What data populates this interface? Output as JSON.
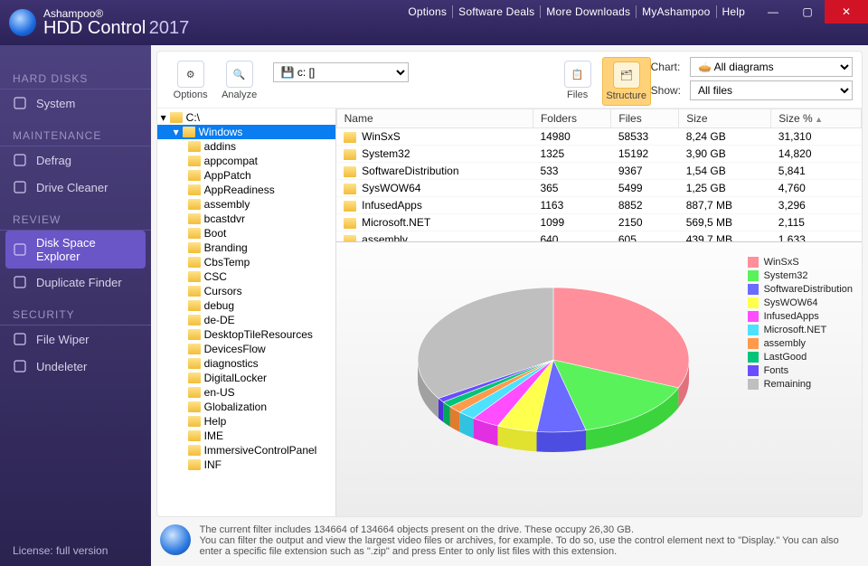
{
  "title": {
    "brand": "Ashampoo®",
    "product": "HDD Control",
    "year": "2017"
  },
  "topmenu": [
    "Options",
    "Software Deals",
    "More Downloads",
    "MyAshampoo",
    "Help"
  ],
  "sidebar": {
    "sections": [
      {
        "title": "HARD DISKS",
        "items": [
          {
            "label": "System",
            "icon": "monitor-icon"
          }
        ]
      },
      {
        "title": "MAINTENANCE",
        "items": [
          {
            "label": "Defrag",
            "icon": "grid-icon"
          },
          {
            "label": "Drive Cleaner",
            "icon": "broom-icon"
          }
        ]
      },
      {
        "title": "REVIEW",
        "items": [
          {
            "label": "Disk Space Explorer",
            "icon": "pie-icon",
            "active": true
          },
          {
            "label": "Duplicate Finder",
            "icon": "copy-icon"
          }
        ]
      },
      {
        "title": "SECURITY",
        "items": [
          {
            "label": "File Wiper",
            "icon": "shred-icon"
          },
          {
            "label": "Undeleter",
            "icon": "undo-icon"
          }
        ]
      }
    ],
    "license": "License: full version"
  },
  "toolbar": {
    "options": "Options",
    "analyze": "Analyze",
    "drive": {
      "selected": "c: []"
    },
    "files": "Files",
    "structure": "Structure",
    "right": {
      "chart_label": "Chart:",
      "chart_value": "All diagrams",
      "show_label": "Show:",
      "show_value": "All files"
    }
  },
  "tree": {
    "root": "C:\\",
    "selected": "Windows",
    "children": [
      "addins",
      "appcompat",
      "AppPatch",
      "AppReadiness",
      "assembly",
      "bcastdvr",
      "Boot",
      "Branding",
      "CbsTemp",
      "CSC",
      "Cursors",
      "debug",
      "de-DE",
      "DesktopTileResources",
      "DevicesFlow",
      "diagnostics",
      "DigitalLocker",
      "en-US",
      "Globalization",
      "Help",
      "IME",
      "ImmersiveControlPanel",
      "INF"
    ]
  },
  "grid": {
    "cols": [
      "Name",
      "Folders",
      "Files",
      "Size",
      "Size %"
    ],
    "rows": [
      {
        "name": "WinSxS",
        "folders": "14980",
        "files": "58533",
        "size": "8,24 GB",
        "pct": "31,310"
      },
      {
        "name": "System32",
        "folders": "1325",
        "files": "15192",
        "size": "3,90 GB",
        "pct": "14,820"
      },
      {
        "name": "SoftwareDistribution",
        "folders": "533",
        "files": "9367",
        "size": "1,54 GB",
        "pct": "5,841"
      },
      {
        "name": "SysWOW64",
        "folders": "365",
        "files": "5499",
        "size": "1,25 GB",
        "pct": "4,760"
      },
      {
        "name": "InfusedApps",
        "folders": "1163",
        "files": "8852",
        "size": "887,7 MB",
        "pct": "3,296"
      },
      {
        "name": "Microsoft.NET",
        "folders": "1099",
        "files": "2150",
        "size": "569,5 MB",
        "pct": "2,115"
      },
      {
        "name": "assembly",
        "folders": "640",
        "files": "605",
        "size": "439,7 MB",
        "pct": "1,633"
      }
    ]
  },
  "chart_data": {
    "type": "pie",
    "series": [
      {
        "name": "WinSxS",
        "value": 31.31,
        "color": "#ff8f9a"
      },
      {
        "name": "System32",
        "value": 14.82,
        "color": "#5af25a"
      },
      {
        "name": "SoftwareDistribution",
        "value": 5.84,
        "color": "#6b6bff"
      },
      {
        "name": "SysWOW64",
        "value": 4.76,
        "color": "#ffff4d"
      },
      {
        "name": "InfusedApps",
        "value": 3.3,
        "color": "#ff4dff"
      },
      {
        "name": "Microsoft.NET",
        "value": 2.12,
        "color": "#4de1ff"
      },
      {
        "name": "assembly",
        "value": 1.63,
        "color": "#ff9a4d"
      },
      {
        "name": "LastGood",
        "value": 1.3,
        "color": "#00c479"
      },
      {
        "name": "Fonts",
        "value": 1.0,
        "color": "#6a4dff"
      },
      {
        "name": "Remaining",
        "value": 33.92,
        "color": "#bfbfbf"
      }
    ]
  },
  "footer": {
    "line1": "The current filter includes 134664 of 134664 objects present on the drive. These occupy 26,30 GB.",
    "line2": "You can filter the output and view the largest video files or archives, for example. To do so, use the control element next to \"Display.\" You can also enter a specific file extension such as \".zip\" and press Enter to only list files with this extension."
  }
}
